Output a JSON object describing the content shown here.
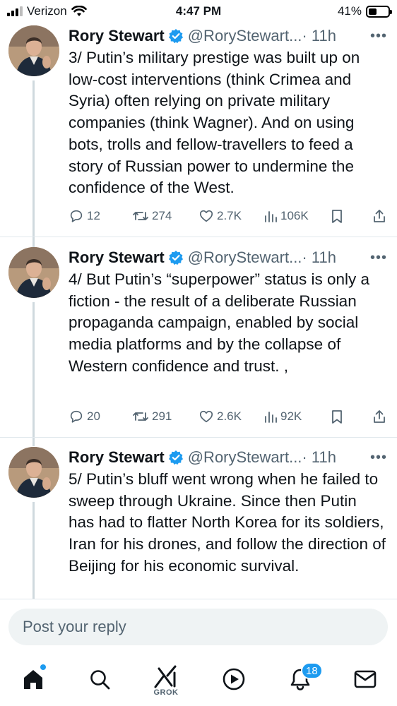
{
  "status_bar": {
    "carrier": "Verizon",
    "time": "4:47 PM",
    "battery": "41%",
    "battery_level": 0.41
  },
  "tweets": [
    {
      "name": "Rory Stewart",
      "handle": "@RoryStewart...",
      "time": "· 11h",
      "text": "3/ Putin’s military prestige was built up on low-cost interventions (think Crimea and Syria) often relying on private military companies (think Wagner). And on using bots, trolls and fellow-travellers to feed a story of Russian power to undermine the confidence of the West.",
      "replies": "12",
      "reposts": "274",
      "likes": "2.7K",
      "views": "106K"
    },
    {
      "name": "Rory Stewart",
      "handle": "@RoryStewart...",
      "time": "· 11h",
      "text": "4/ But Putin’s “superpower” status is only a fiction - the result of a deliberate Russian propaganda campaign, enabled by social media platforms and by the collapse of Western confidence and trust. ,",
      "replies": "20",
      "reposts": "291",
      "likes": "2.6K",
      "views": "92K"
    },
    {
      "name": "Rory Stewart",
      "handle": "@RoryStewart...",
      "time": "· 11h",
      "text": "5/ Putin’s bluff went wrong when he failed to sweep through Ukraine.  Since then Putin has had to flatter North Korea for its soldiers, Iran for his drones, and follow the direction of Beijing for his economic survival."
    }
  ],
  "reply": {
    "placeholder": "Post your reply"
  },
  "bottom_nav": {
    "grok_label": "GROK",
    "notifications_count": "18",
    "items": [
      "home-icon",
      "search-icon",
      "grok-icon",
      "play-icon",
      "bell-icon",
      "mail-icon"
    ]
  },
  "colors": {
    "accent": "#1d9bf0",
    "muted": "#536471",
    "text": "#0f1419"
  }
}
